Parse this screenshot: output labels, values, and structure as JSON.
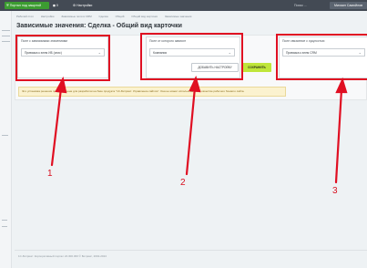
{
  "topbar": {
    "portal_button": "Портал под защитой",
    "count": "0",
    "settings": "Настройки",
    "search": "Поиск ...",
    "user": "Михаил Самойлов"
  },
  "breadcrumbs": [
    "Рабочий стол",
    "Настройки",
    "Зависимые поля в CRM",
    "Сделка",
    "Общий",
    "Общий вид карточки",
    "Зависимые значения"
  ],
  "page_title": "Зависимые значения: Сделка - Общий вид карточки",
  "panels": {
    "dependent": {
      "header": "Поле с зависимыми значениями",
      "value": "Привязка к элем ИБ (спис)"
    },
    "source": {
      "header": "Поле от которого зависит",
      "value": "Компания"
    },
    "entity": {
      "header": "Поле связанное с сущностью",
      "value": "Привязка к элем CRM"
    }
  },
  "buttons": {
    "add_setting": "ДОБАВИТЬ НАСТРОЙКУ",
    "save": "СОХРАНИТЬ"
  },
  "notice": "Это установка решения предназначена для разработки на базе продукта \"1С-Битрикс: Управление сайтом\". Она не может использоваться в качестве рабочего боевого сайта.",
  "footer": "1С-Битрикс: Корпоративный портал 24.300.300 © Битрикс, 2002-2024",
  "annotations": {
    "one": "1",
    "two": "2",
    "three": "3"
  },
  "colors": {
    "highlight": "#e00f22",
    "save_button": "#bfe63a",
    "portal_button": "#3c9c31",
    "topbar": "#434a54"
  }
}
